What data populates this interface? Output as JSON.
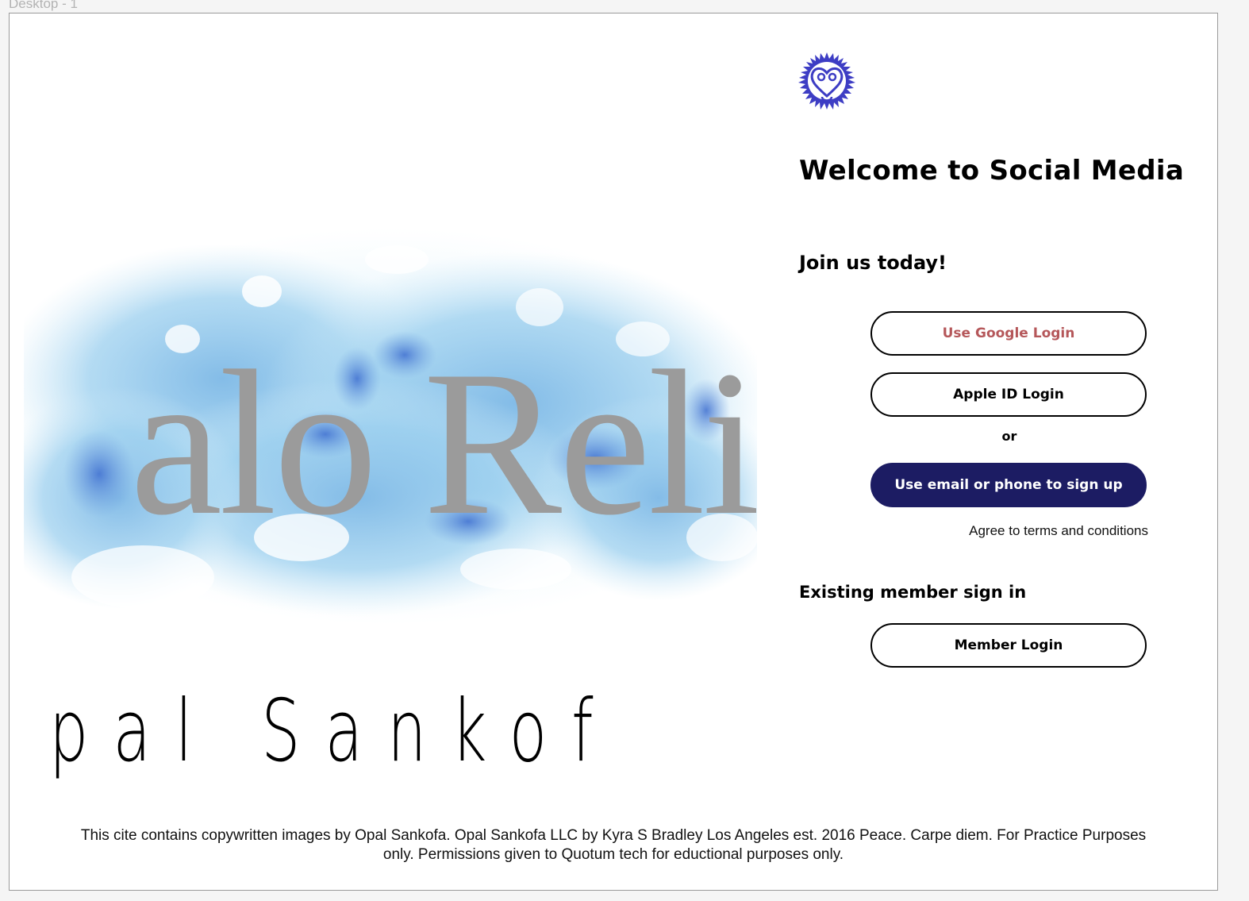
{
  "frame": {
    "label": "Desktop - 1"
  },
  "hero": {
    "main_word": "alo Reli",
    "sub_word": "pal Sankof"
  },
  "header": {
    "title": "Welcome to Social Media",
    "subtitle": "Join us today!"
  },
  "signup": {
    "google_label": "Use Google Login",
    "apple_label": "Apple ID Login",
    "or_label": "or",
    "email_label": "Use email or phone to sign up",
    "terms_label": "Agree to terms and conditions"
  },
  "existing": {
    "title": "Existing member sign in",
    "member_label": "Member Login"
  },
  "footer": {
    "text": "This cite contains copywritten images by Opal Sankofa. Opal Sankofa LLC by Kyra S Bradley Los Angeles est. 2016 Peace. Carpe diem. For Practice Purposes only. Permissions given to Quotum tech for eductional purposes only."
  },
  "colors": {
    "primary_button": "#1c1c63",
    "google_text": "#b5575a",
    "logo": "#3d3dc4",
    "watercolor": "#7ec3e8"
  },
  "icons": {
    "logo": "sankofa-heart-icon"
  }
}
